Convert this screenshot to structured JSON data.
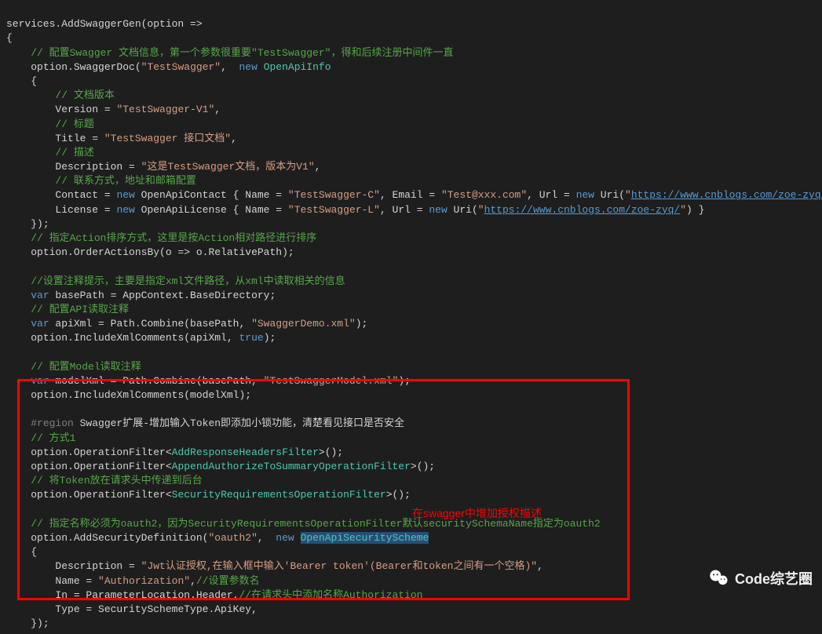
{
  "code": {
    "line1": "services.AddSwaggerGen(option =>",
    "line2": "{",
    "comment1": "// 配置Swagger 文档信息，第一个参数很重要\"TestSwagger\"，得和后续注册中间件一直",
    "line3_a": "option.SwaggerDoc(",
    "line3_b": "\"TestSwagger\"",
    "line3_c": ",  ",
    "line3_d": "new",
    "line3_e": " OpenApiInfo",
    "line4": "{",
    "comment2": "// 文档版本",
    "line5_a": "Version = ",
    "line5_b": "\"TestSwagger-V1\"",
    "line5_c": ",",
    "comment3": "// 标题",
    "line6_a": "Title = ",
    "line6_b": "\"TestSwagger 接口文档\"",
    "line6_c": ",",
    "comment4": "// 描述",
    "line7_a": "Description = ",
    "line7_b": "\"这是TestSwagger文档，版本为V1\"",
    "line7_c": ",",
    "comment5": "// 联系方式，地址和邮箱配置",
    "line8_a": "Contact = ",
    "line8_b": "new",
    "line8_c": " OpenApiContact { Name = ",
    "line8_d": "\"TestSwagger-C\"",
    "line8_e": ", Email = ",
    "line8_f": "\"Test@xxx.com\"",
    "line8_g": ", Url = ",
    "line8_h": "new",
    "line8_i": " Uri(",
    "line8_j": "\"",
    "line8_k": "https://www.cnblogs.com/zoe-zyq/",
    "line8_l": "\"",
    "line8_m": ") },",
    "line9_a": "License = ",
    "line9_b": "new",
    "line9_c": " OpenApiLicense { Name = ",
    "line9_d": "\"TestSwagger-L\"",
    "line9_e": ", Url = ",
    "line9_f": "new",
    "line9_g": " Uri(",
    "line9_h": "\"",
    "line9_i": "https://www.cnblogs.com/zoe-zyq/",
    "line9_j": "\"",
    "line9_k": ") }",
    "line10": "});",
    "comment6": "// 指定Action排序方式，这里是按Action相对路径进行排序",
    "line11": "option.OrderActionsBy(o => o.RelativePath);",
    "comment7": "//设置注释提示，主要是指定xml文件路径，从xml中读取相关的信息",
    "line12_a": "var",
    "line12_b": " basePath = AppContext.BaseDirectory;",
    "comment8": "// 配置API读取注释",
    "line13_a": "var",
    "line13_b": " apiXml = Path.Combine(basePath, ",
    "line13_c": "\"SwaggerDemo.xml\"",
    "line13_d": ");",
    "line14_a": "option.IncludeXmlComments(apiXml, ",
    "line14_b": "true",
    "line14_c": ");",
    "comment9": "// 配置Model读取注释",
    "line15_a": "var",
    "line15_b": " modelXml = Path.Combine(basePath, ",
    "line15_c": "\"TestSwaggerModel.xml\"",
    "line15_d": ");",
    "line16": "option.IncludeXmlComments(modelXml);",
    "region1": "#region",
    "region1_txt": " Swagger扩展-增加输入Token即添加小锁功能，清楚看见接口是否安全",
    "comment10": "// 方式1",
    "line17_a": "option.OperationFilter<",
    "line17_b": "AddResponseHeadersFilter",
    "line17_c": ">();",
    "line18_a": "option.OperationFilter<",
    "line18_b": "AppendAuthorizeToSummaryOperationFilter",
    "line18_c": ">();",
    "comment11": "// 将Token放在请求头中传递到后台",
    "line19_a": "option.OperationFilter<",
    "line19_b": "SecurityRequirementsOperationFilter",
    "line19_c": ">();",
    "comment12": "// 指定名称必须为oauth2，因为SecurityRequirementsOperationFilter默认securitySchemaName指定为oauth2",
    "line20_a": "option.AddSecurityDefinition(",
    "line20_b": "\"oauth2\"",
    "line20_c": ",  ",
    "line20_d": "new",
    "line20_e": " ",
    "line20_f": "OpenApiSecurityScheme",
    "line21": "{",
    "line22_a": "Description = ",
    "line22_b": "\"Jwt认证授权,在输入框中输入'Bearer token'(Bearer和token之间有一个空格)\"",
    "line22_c": ",",
    "line23_a": "Name = ",
    "line23_b": "\"Authorization\"",
    "line23_c": ",",
    "line23_d": "//设置参数名",
    "line24_a": "In = ParameterLocation.Header,",
    "line24_b": "//在请求头中添加名称Authorization",
    "line25": "Type = SecuritySchemeType.ApiKey,",
    "line26": "});"
  },
  "annotation": "在swagger中增加授权描述",
  "watermark": "Code综艺圈"
}
